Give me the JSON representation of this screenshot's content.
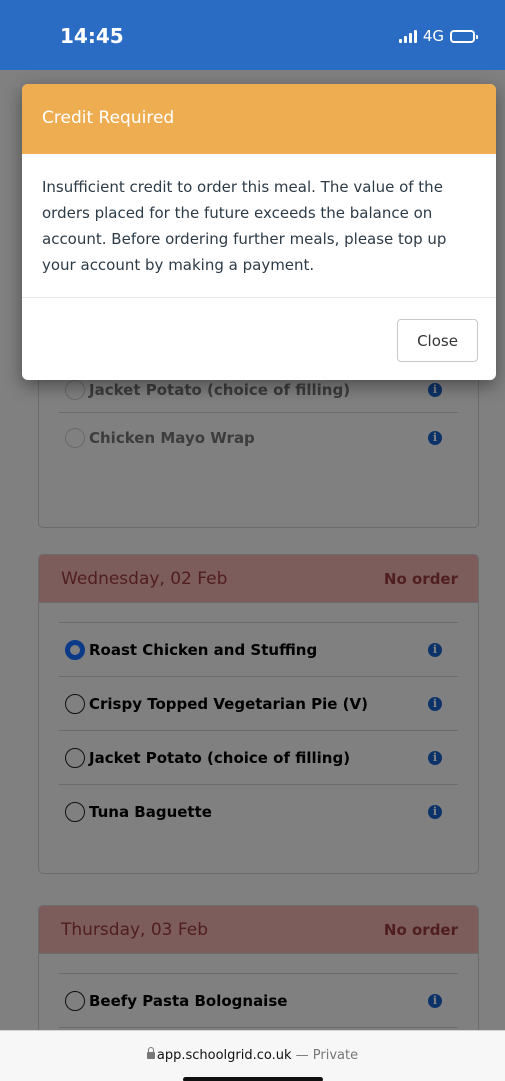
{
  "status_bar": {
    "time": "14:45",
    "network": "4G"
  },
  "dialog": {
    "title": "Credit Required",
    "message": "Insufficient credit to order this meal. The value of the orders placed for the future exceeds the balance on account. Before ordering further meals, please top up your account by making a payment.",
    "close_label": "Close",
    "header_color": "#EEAD50"
  },
  "days": [
    {
      "meals": [
        {
          "name": "Jacket Potato (choice of filling)",
          "selected": false
        },
        {
          "name": "Chicken Mayo Wrap",
          "selected": false
        }
      ]
    },
    {
      "date": "Wednesday, 02 Feb",
      "status": "No order",
      "meals": [
        {
          "name": "Roast Chicken and Stuffing",
          "selected": true
        },
        {
          "name": "Crispy Topped Vegetarian Pie (V)",
          "selected": false
        },
        {
          "name": "Jacket Potato (choice of filling)",
          "selected": false
        },
        {
          "name": "Tuna Baguette",
          "selected": false
        }
      ]
    },
    {
      "date": "Thursday, 03 Feb",
      "status": "No order",
      "meals": [
        {
          "name": "Beefy Pasta Bolognaise",
          "selected": false
        }
      ]
    }
  ],
  "browser": {
    "domain": "app.schoolgrid.co.uk",
    "separator": "—",
    "mode": "Private"
  },
  "colors": {
    "status_bar": "#2A6BC4",
    "selected_radio": "#0B3A88"
  }
}
